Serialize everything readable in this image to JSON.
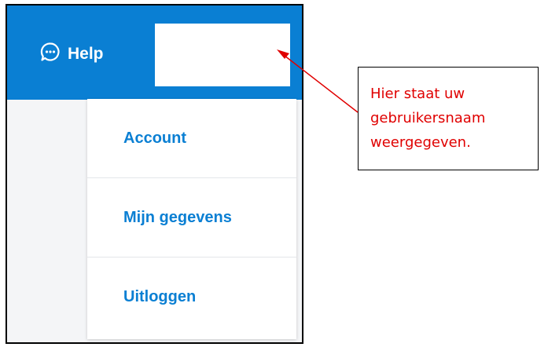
{
  "header": {
    "help_label": "Help",
    "username": ""
  },
  "menu": {
    "items": [
      {
        "label": "Account"
      },
      {
        "label": "Mijn gegevens"
      },
      {
        "label": "Uitloggen"
      }
    ]
  },
  "annotation": {
    "lines": [
      "Hier staat uw",
      "gebruikersnaam",
      "weergegeven."
    ]
  },
  "colors": {
    "brand_blue": "#0a7fd3",
    "annotation_red": "#e00000"
  },
  "icons": {
    "help": "chat-bubble-icon"
  }
}
